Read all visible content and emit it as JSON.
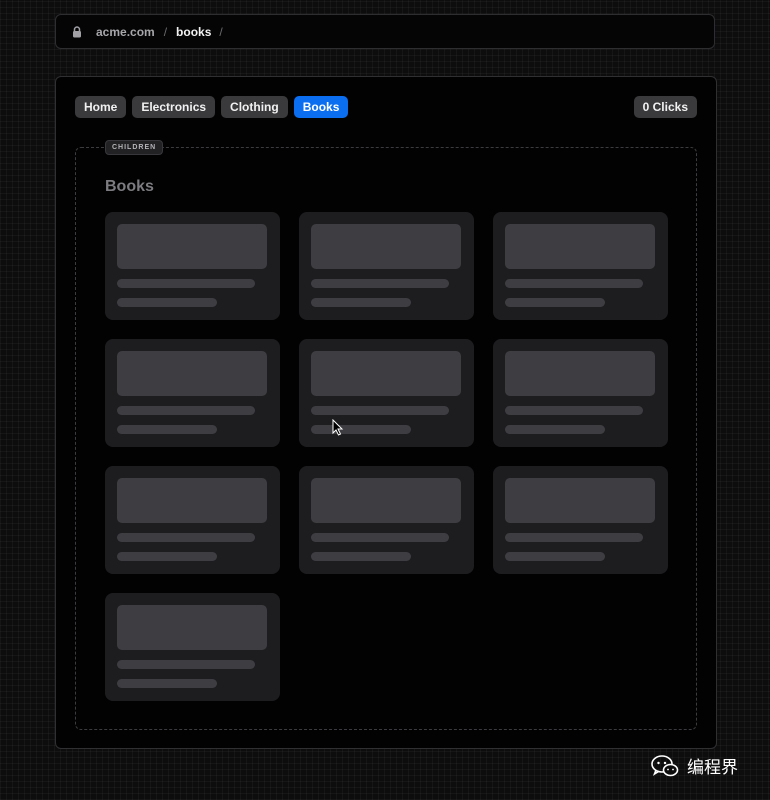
{
  "address_bar": {
    "domain": "acme.com",
    "separator": "/",
    "path": "books",
    "trailing_separator": "/",
    "icon": "lock-icon"
  },
  "nav": {
    "tabs": [
      {
        "label": "Home",
        "active": false
      },
      {
        "label": "Electronics",
        "active": false
      },
      {
        "label": "Clothing",
        "active": false
      },
      {
        "label": "Books",
        "active": true
      }
    ],
    "clicks_label": "0 Clicks",
    "accent_color": "#0b6ef0"
  },
  "children": {
    "label": "CHILDREN",
    "title": "Books",
    "skeleton_card_count": 10
  },
  "watermark": {
    "icon": "wechat-icon",
    "text": "编程界"
  }
}
